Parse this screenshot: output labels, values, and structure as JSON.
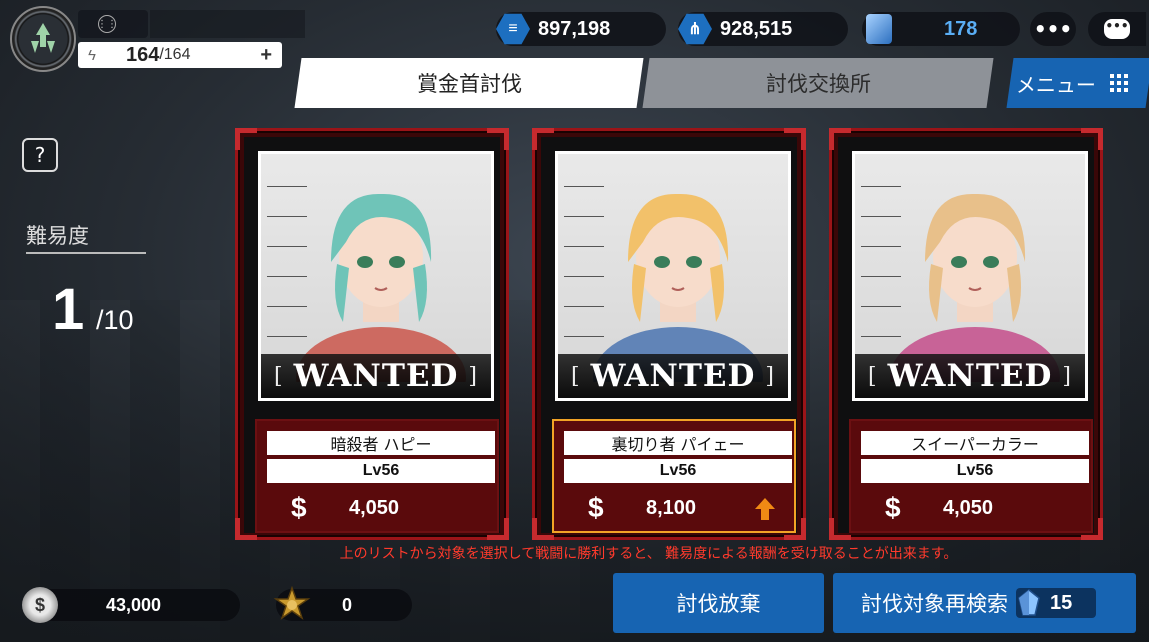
{
  "player": {
    "stamina_current": "164",
    "stamina_max": "/164",
    "stamina_plus": "+"
  },
  "currencies": [
    {
      "icon": "list-icon",
      "value": "897,198"
    },
    {
      "icon": "network-icon",
      "value": "928,515"
    },
    {
      "icon": "crystal-icon",
      "value": "178",
      "color": "#5aaef5"
    }
  ],
  "header": {
    "more_label": "•••",
    "chat_label": "•••"
  },
  "tabs": [
    {
      "label": "賞金首討伐",
      "active": true
    },
    {
      "label": "討伐交換所",
      "active": false
    }
  ],
  "menu": {
    "label": "メニュー"
  },
  "difficulty": {
    "help_label": "?",
    "label": "難易度",
    "value": "1",
    "max": "/10"
  },
  "targets": [
    {
      "name": "暗殺者 ハピー",
      "level": "Lv56",
      "currency_symbol": "$",
      "reward": "4,050",
      "selected": false,
      "wanted_left": "[",
      "wanted_label": "WANTED",
      "wanted_right": "]",
      "hair": "#6fc4b8",
      "accent": "#c83a2e"
    },
    {
      "name": "裏切り者 パイェー",
      "level": "Lv56",
      "currency_symbol": "$",
      "reward": "8,100",
      "selected": true,
      "bonus": "up-arrow-icon",
      "wanted_left": "[",
      "wanted_label": "WANTED",
      "wanted_right": "]",
      "hair": "#f2c16a",
      "accent": "#2d5fa8"
    },
    {
      "name": "スイーパーカラー",
      "level": "Lv56",
      "currency_symbol": "$",
      "reward": "4,050",
      "selected": false,
      "wanted_left": "[",
      "wanted_label": "WANTED",
      "wanted_right": "]",
      "hair": "#e8c08a",
      "accent": "#c0307a"
    }
  ],
  "hint": "上のリストから対象を選択して戦闘に勝利すると、 難易度による報酬を受け取ることが出来ます。",
  "footer": {
    "money_symbol": "$",
    "money": "43,000",
    "badge_count": "0",
    "abandon_label": "討伐放棄",
    "research_label": "討伐対象再検索",
    "research_cost": "15"
  },
  "colors": {
    "accent_blue": "#1764b2",
    "card_red": "#9b1418",
    "selected_border": "#f2a426",
    "hint_red": "#ff3a2c"
  }
}
